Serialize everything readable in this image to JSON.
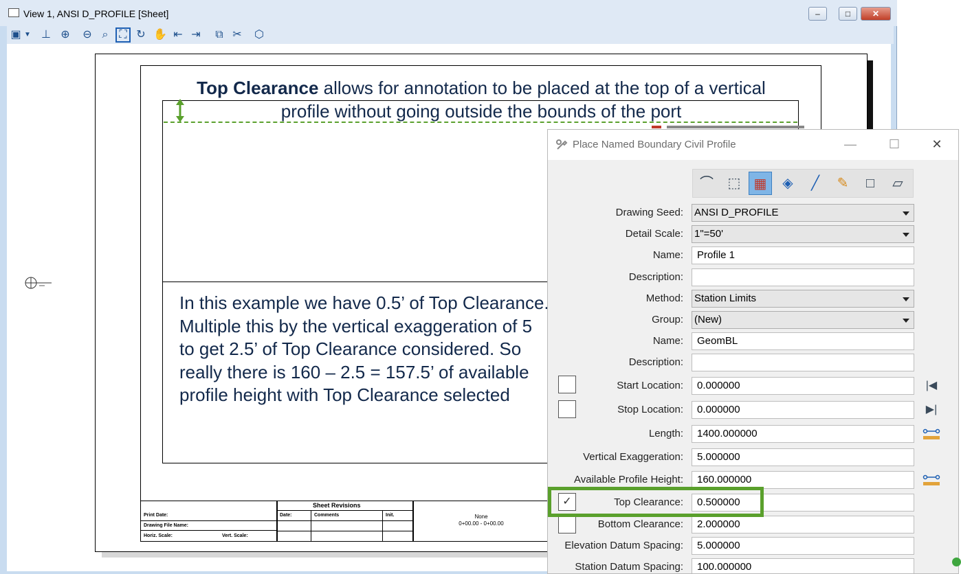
{
  "view_window": {
    "title": "View 1, ANSI D_PROFILE [Sheet]",
    "buttons": {
      "minimize": "–",
      "maximize": "□",
      "close": "✕"
    },
    "toolbar_icons": [
      "view-attributes-icon",
      "dropdown-arrow-icon",
      "update-icon",
      "zoom-in-icon",
      "zoom-out-icon",
      "window-area-icon",
      "fit-view-icon",
      "rotate-view-icon",
      "pan-icon",
      "previous-view-icon",
      "next-view-icon",
      "copy-view-icon",
      "clip-volume-icon",
      "camera-icon"
    ]
  },
  "annotation": {
    "top_bold": "Top Clearance",
    "top_rest": " allows for annotation to be placed at the top of a vertical profile without going outside the bounds of the port",
    "body": "In this example we have 0.5’ of Top Clearance. Multiple this by the vertical exaggeration of 5 to get 2.5’ of Top Clearance considered. So really there is 160 – 2.5 = 157.5’ of available profile height with Top Clearance selected",
    "accent_color": "#5aa02c"
  },
  "title_block": {
    "print_date": "Print Date:",
    "drawing_file": "Drawing File Name:",
    "horiz_scale": "Horiz. Scale:",
    "vert_scale": "Vert. Scale:",
    "revisions_header": "Sheet Revisions",
    "date_col": "Date:",
    "comments_col": "Comments",
    "init_col": "Init.",
    "none_text": "None",
    "station_range": "0+00.00 - 0+00.00"
  },
  "dialog": {
    "title": "Place Named Boundary Civil Profile",
    "controls": {
      "minimize": "—",
      "maximize": "☐",
      "close": "✕"
    },
    "mode_buttons": [
      "civil-plan-icon",
      "civil-profile-icon",
      "grid-profile-icon",
      "xs-icon",
      "line-icon",
      "pencil-icon",
      "box-icon",
      "shape-icon"
    ],
    "rows": {
      "drawing_seed": {
        "label": "Drawing Seed:",
        "value": "ANSI D_PROFILE"
      },
      "detail_scale": {
        "label": "Detail Scale:",
        "value": "1\"=50'"
      },
      "name": {
        "label": "Name:",
        "value": "Profile 1"
      },
      "description": {
        "label": "Description:",
        "value": ""
      },
      "method": {
        "label": "Method:",
        "value": "Station Limits"
      },
      "group": {
        "label": "Group:",
        "value": "(New)"
      },
      "group_name": {
        "label": "Name:",
        "value": "GeomBL"
      },
      "group_description": {
        "label": "Description:",
        "value": ""
      },
      "start_location": {
        "label": "Start Location:",
        "value": "0.000000",
        "checked": false
      },
      "stop_location": {
        "label": "Stop Location:",
        "value": "0.000000",
        "checked": false
      },
      "length": {
        "label": "Length:",
        "value": "1400.000000"
      },
      "vertical_exaggeration": {
        "label": "Vertical Exaggeration:",
        "value": "5.000000"
      },
      "available_profile_height": {
        "label": "Available Profile Height:",
        "value": "160.000000"
      },
      "top_clearance": {
        "label": "Top Clearance:",
        "value": "0.500000",
        "checked": true
      },
      "bottom_clearance": {
        "label": "Bottom Clearance:",
        "value": "2.000000",
        "checked": false
      },
      "elevation_datum_spacing": {
        "label": "Elevation Datum Spacing:",
        "value": "5.000000"
      },
      "station_datum_spacing": {
        "label": "Station Datum Spacing:",
        "value": "100.000000"
      }
    },
    "side_icons": {
      "start": "|◀",
      "stop": "▶|"
    },
    "checkmark": "✓"
  }
}
